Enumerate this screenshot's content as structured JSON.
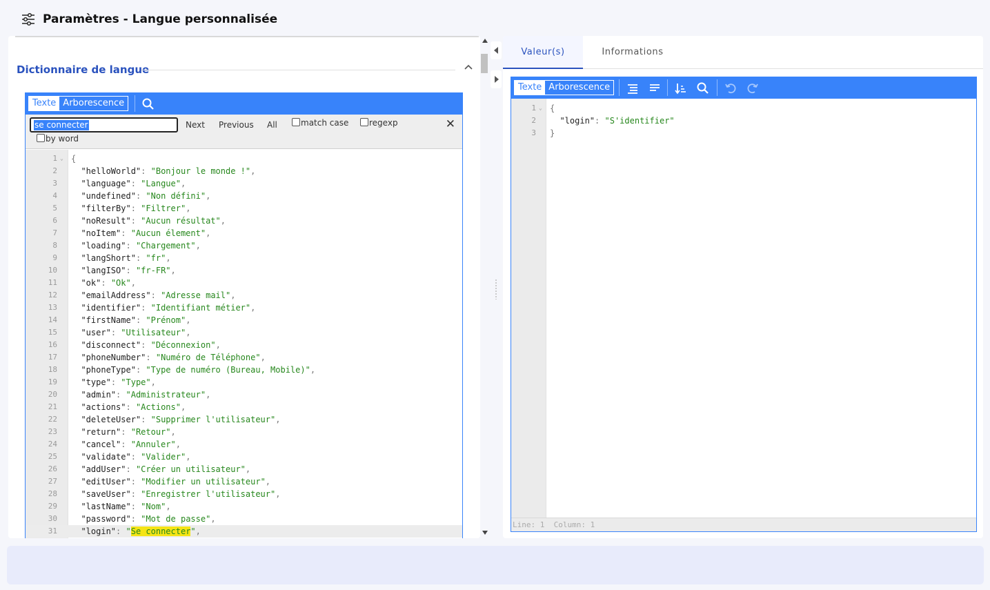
{
  "header": {
    "title": "Paramètres - Langue personnalisée",
    "icon": "sliders-icon"
  },
  "left": {
    "section_title": "Dictionnaire de langue",
    "toolbar": {
      "mode_text": "Texte",
      "mode_tree": "Arborescence"
    },
    "search": {
      "value": "se connecter",
      "next": "Next",
      "previous": "Previous",
      "all": "All",
      "match_case": "match case",
      "regexp": "regexp",
      "by_word": "by word",
      "close": "✕"
    },
    "code_lines": [
      {
        "n": "1",
        "t": "{"
      },
      {
        "n": "2",
        "k": "helloWorld",
        "v": "Bonjour le monde !"
      },
      {
        "n": "3",
        "k": "language",
        "v": "Langue"
      },
      {
        "n": "4",
        "k": "undefined",
        "v": "Non défini"
      },
      {
        "n": "5",
        "k": "filterBy",
        "v": "Filtrer"
      },
      {
        "n": "6",
        "k": "noResult",
        "v": "Aucun résultat"
      },
      {
        "n": "7",
        "k": "noItem",
        "v": "Aucun élement"
      },
      {
        "n": "8",
        "k": "loading",
        "v": "Chargement"
      },
      {
        "n": "9",
        "k": "langShort",
        "v": "fr"
      },
      {
        "n": "10",
        "k": "langISO",
        "v": "fr-FR"
      },
      {
        "n": "11",
        "k": "ok",
        "v": "Ok"
      },
      {
        "n": "12",
        "k": "emailAddress",
        "v": "Adresse mail"
      },
      {
        "n": "13",
        "k": "identifier",
        "v": "Identifiant métier"
      },
      {
        "n": "14",
        "k": "firstName",
        "v": "Prénom"
      },
      {
        "n": "15",
        "k": "user",
        "v": "Utilisateur"
      },
      {
        "n": "16",
        "k": "disconnect",
        "v": "Déconnexion"
      },
      {
        "n": "17",
        "k": "phoneNumber",
        "v": "Numéro de Téléphone"
      },
      {
        "n": "18",
        "k": "phoneType",
        "v": "Type de numéro (Bureau, Mobile)"
      },
      {
        "n": "19",
        "k": "type",
        "v": "Type"
      },
      {
        "n": "20",
        "k": "admin",
        "v": "Administrateur"
      },
      {
        "n": "21",
        "k": "actions",
        "v": "Actions"
      },
      {
        "n": "22",
        "k": "deleteUser",
        "v": "Supprimer l'utilisateur"
      },
      {
        "n": "23",
        "k": "return",
        "v": "Retour"
      },
      {
        "n": "24",
        "k": "cancel",
        "v": "Annuler"
      },
      {
        "n": "25",
        "k": "validate",
        "v": "Valider"
      },
      {
        "n": "26",
        "k": "addUser",
        "v": "Créer un utilisateur"
      },
      {
        "n": "27",
        "k": "editUser",
        "v": "Modifier un utilisateur"
      },
      {
        "n": "28",
        "k": "saveUser",
        "v": "Enregistrer l'utilisateur"
      },
      {
        "n": "29",
        "k": "lastName",
        "v": "Nom"
      },
      {
        "n": "30",
        "k": "password",
        "v": "Mot de passe"
      },
      {
        "n": "31",
        "k": "login",
        "v": "Se connecter",
        "highlight": true,
        "active": true
      }
    ]
  },
  "right": {
    "tabs": [
      "Valeur(s)",
      "Informations"
    ],
    "toolbar": {
      "mode_text": "Texte",
      "mode_tree": "Arborescence"
    },
    "code_lines": [
      {
        "n": "1",
        "t": "{"
      },
      {
        "n": "2",
        "k": "login",
        "v": "S'identifier",
        "last": true
      },
      {
        "n": "3",
        "t": "}"
      }
    ],
    "status": "Line: 1  Column: 1"
  },
  "colors": {
    "accent": "#3883fa",
    "brand": "#2a52be",
    "string": "#26871c",
    "match": "#f5e416"
  }
}
